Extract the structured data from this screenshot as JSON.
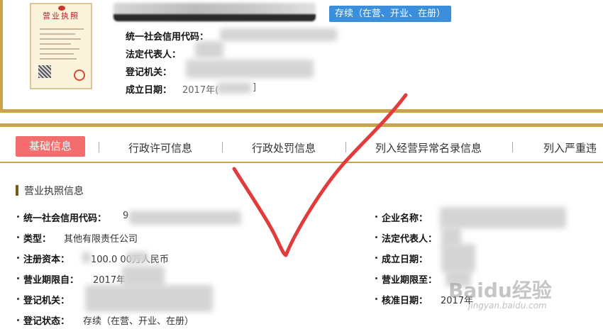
{
  "header": {
    "status_badge": "存续（在营、开业、在册）",
    "fields": [
      {
        "label": "统一社会信用代码：",
        "value": ""
      },
      {
        "label": "法定代表人：",
        "value": ""
      },
      {
        "label": "登记机关：",
        "value": ""
      },
      {
        "label": "成立日期：",
        "value": "2017年("
      }
    ],
    "date_suffix": "]"
  },
  "tabs": [
    {
      "label": "基础信息",
      "active": true
    },
    {
      "label": "行政许可信息",
      "active": false
    },
    {
      "label": "行政处罚信息",
      "active": false
    },
    {
      "label": "列入经营异常名录信息",
      "active": false
    },
    {
      "label": "列入严重违",
      "active": false
    }
  ],
  "license_section": {
    "title": "营业执照信息",
    "left_fields": [
      {
        "label": "统一社会信用代码：",
        "value": "9"
      },
      {
        "label": "类型：",
        "value": "其他有限责任公司"
      },
      {
        "label": "注册资本：",
        "value": "100.0    00万人民币"
      },
      {
        "label": "营业期限自：",
        "value": "2017年"
      },
      {
        "label": "登记机关：",
        "value": ""
      },
      {
        "label": "登记状态：",
        "value": "存续（在营、开业、在册）"
      }
    ],
    "right_fields": [
      {
        "label": "企业名称：",
        "value": ""
      },
      {
        "label": "法定代表人：",
        "value": ""
      },
      {
        "label": "成立日期：",
        "value": ""
      },
      {
        "label": "营业期限至：",
        "value": ""
      },
      {
        "label": "核准日期：",
        "value": "2017年"
      }
    ]
  },
  "license_image": {
    "heading": "营业执照"
  },
  "watermark": {
    "logo": "Baidu经验",
    "url": "jingyan.baidu.com"
  },
  "colors": {
    "gold": "#c9a44b",
    "active_tab": "#f26d6d",
    "badge": "#3b8edc",
    "check": "#e23b3b"
  }
}
